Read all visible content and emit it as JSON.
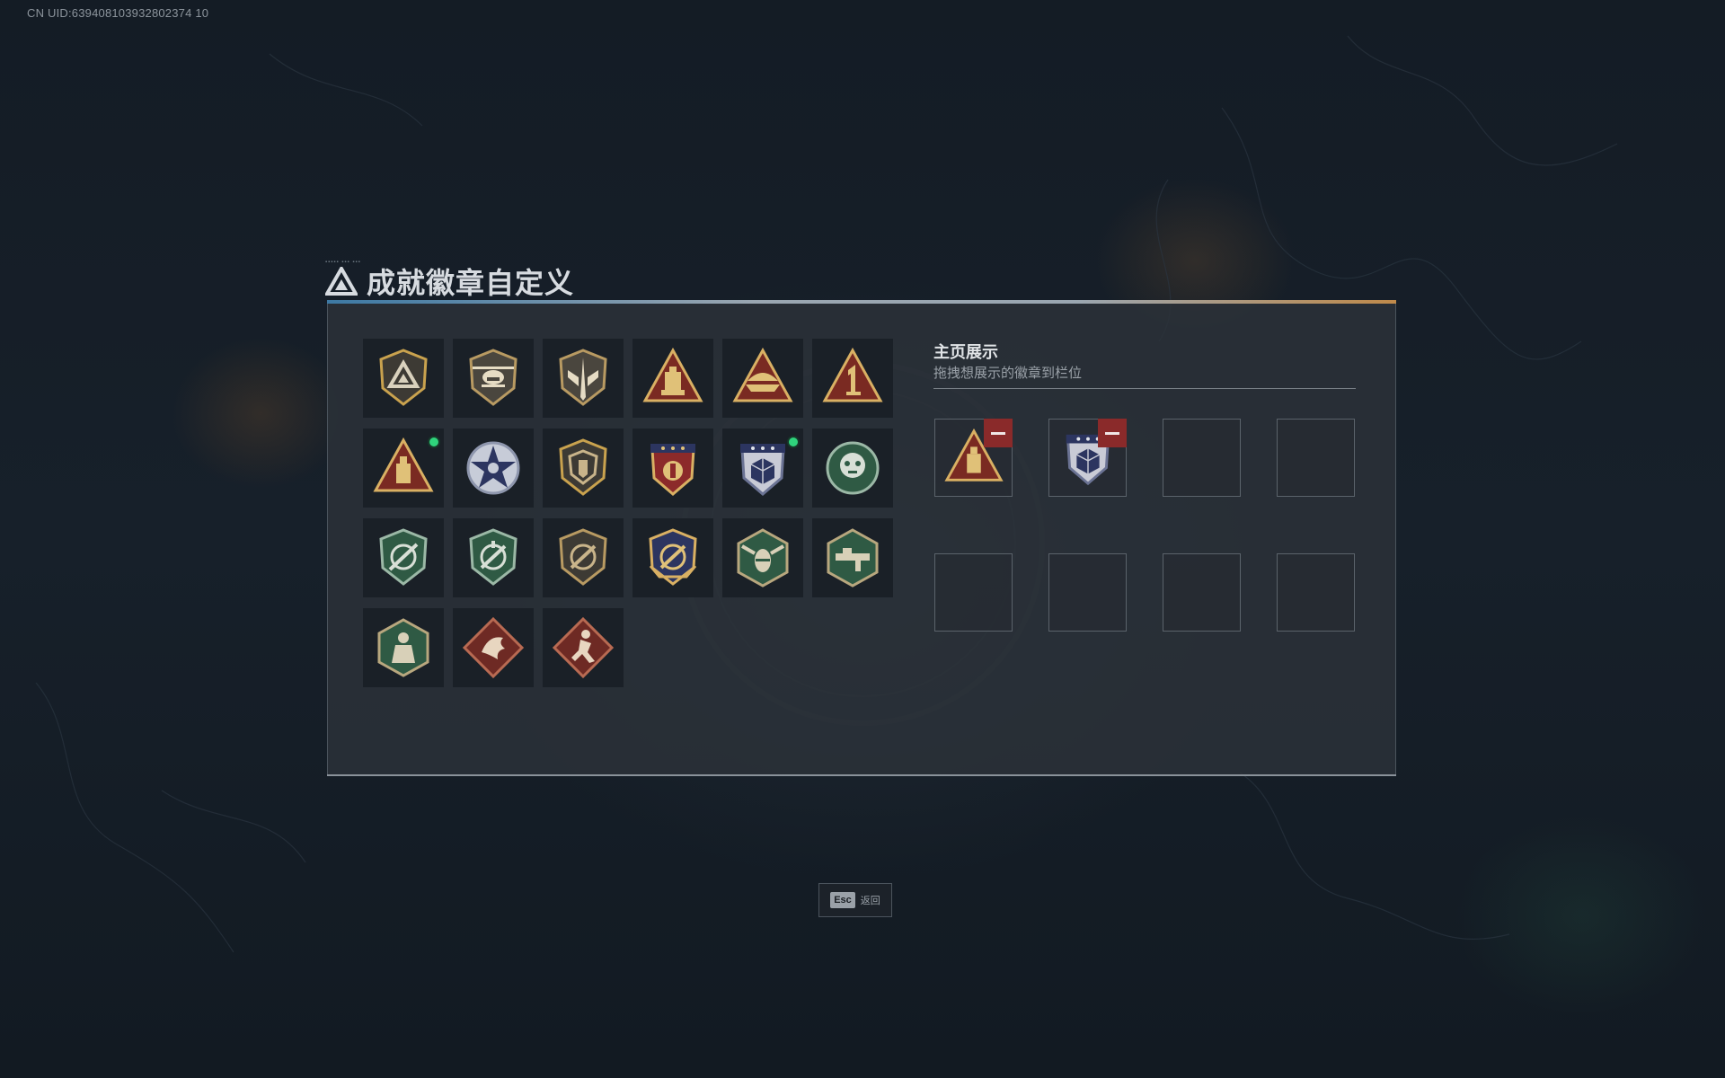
{
  "uid_text": "CN UID:639408103932802374 10",
  "header": {
    "title": "成就徽章自定义"
  },
  "showcase": {
    "title": "主页展示",
    "subtitle": "拖拽想展示的徽章到栏位"
  },
  "footer": {
    "esc_key": "Esc",
    "esc_label": "返回"
  },
  "colors": {
    "gold": "#c9a24e",
    "dark_red": "#8a2a2a",
    "green_dot": "#2fd47c",
    "navy": "#2c3560",
    "green_shield": "#2f5a44"
  },
  "badges": [
    {
      "icon": "gold-triangle-shield-icon",
      "new": false
    },
    {
      "icon": "helicopter-badge-icon",
      "new": false
    },
    {
      "icon": "tactical-shield-icon",
      "new": false
    },
    {
      "icon": "gold-triangle-building-icon",
      "new": false
    },
    {
      "icon": "gold-triangle-boat-icon",
      "new": false
    },
    {
      "icon": "gold-triangle-number-one-icon",
      "new": false
    },
    {
      "icon": "gold-triangle-tower-icon",
      "new": true
    },
    {
      "icon": "blue-star-emblem-icon",
      "new": false
    },
    {
      "icon": "bronze-shield-icon",
      "new": false
    },
    {
      "icon": "star-crest-gold-icon",
      "new": false
    },
    {
      "icon": "navy-crest-dice-icon",
      "new": true
    },
    {
      "icon": "green-round-emblem-icon",
      "new": false
    },
    {
      "icon": "green-shield-crosshair-icon",
      "new": false
    },
    {
      "icon": "green-shield-crosshair-alt-icon",
      "new": false
    },
    {
      "icon": "dark-shield-crosshair-icon",
      "new": false
    },
    {
      "icon": "gold-shield-crosshair-icon",
      "new": false
    },
    {
      "icon": "hexagon-bee-icon",
      "new": false
    },
    {
      "icon": "hexagon-gun-icon",
      "new": false
    },
    {
      "icon": "hexagon-soldier-icon",
      "new": false
    },
    {
      "icon": "diamond-dragon-icon",
      "new": false
    },
    {
      "icon": "diamond-runner-icon",
      "new": false
    }
  ],
  "slots": [
    {
      "icon": "gold-triangle-tower-icon",
      "filled": true
    },
    {
      "icon": "navy-crest-dice-icon",
      "filled": true
    },
    {
      "icon": "",
      "filled": false
    },
    {
      "icon": "",
      "filled": false
    },
    {
      "icon": "",
      "filled": false
    },
    {
      "icon": "",
      "filled": false
    },
    {
      "icon": "",
      "filled": false
    },
    {
      "icon": "",
      "filled": false
    }
  ]
}
